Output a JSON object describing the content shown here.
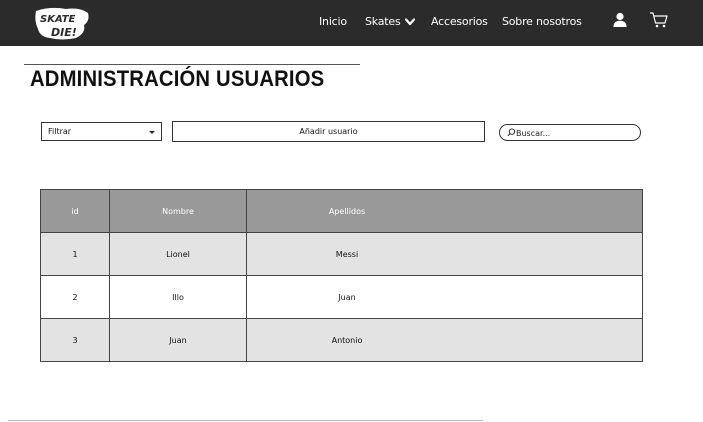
{
  "header": {
    "logo_text": "Skate or Die!",
    "nav": [
      "Inicio",
      "Skates",
      "Accesorios",
      "Sobre nosotros"
    ],
    "icons": [
      "user-icon",
      "cart-icon",
      "chevron-down-icon"
    ]
  },
  "page": {
    "title": "ADMINISTRACIÓN USUARIOS"
  },
  "controls": {
    "filter_label": "Filtrar",
    "add_button": "Añadir usuario",
    "search_placeholder": "Buscar..."
  },
  "table": {
    "headers": [
      "id",
      "Nombre",
      "Apellidos"
    ],
    "rows": [
      [
        "1",
        "Lionel",
        "Messi"
      ],
      [
        "2",
        "Illo",
        "Juan"
      ],
      [
        "3",
        "Juan",
        "Antonio"
      ]
    ]
  },
  "colors": {
    "navbar": "#2b2b2b",
    "table_header": "#999999",
    "row_shade": "#e3e3e3"
  }
}
